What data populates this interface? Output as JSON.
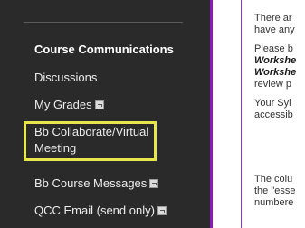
{
  "sidebar": {
    "section_heading": "Course Communications",
    "items": [
      {
        "label": "Discussions",
        "external": false
      },
      {
        "label": "My Grades",
        "external": true
      },
      {
        "label": "Bb Collaborate/Virtual Meeting",
        "external": false,
        "highlighted": true
      },
      {
        "label": "Bb Course Messages",
        "external": true
      },
      {
        "label": "QCC Email (send only)",
        "external": true
      }
    ]
  },
  "content": {
    "lines": [
      "There ar",
      "have any",
      "Please b",
      "Workshe",
      "Workshe",
      "review p",
      "Your Syl",
      "accessib",
      "The colu",
      "the \"esse",
      "numbere"
    ]
  },
  "colors": {
    "sidebar_bg": "#2a2a2a",
    "highlight_border": "#e7e64a",
    "accent": "#8a1bb8"
  }
}
